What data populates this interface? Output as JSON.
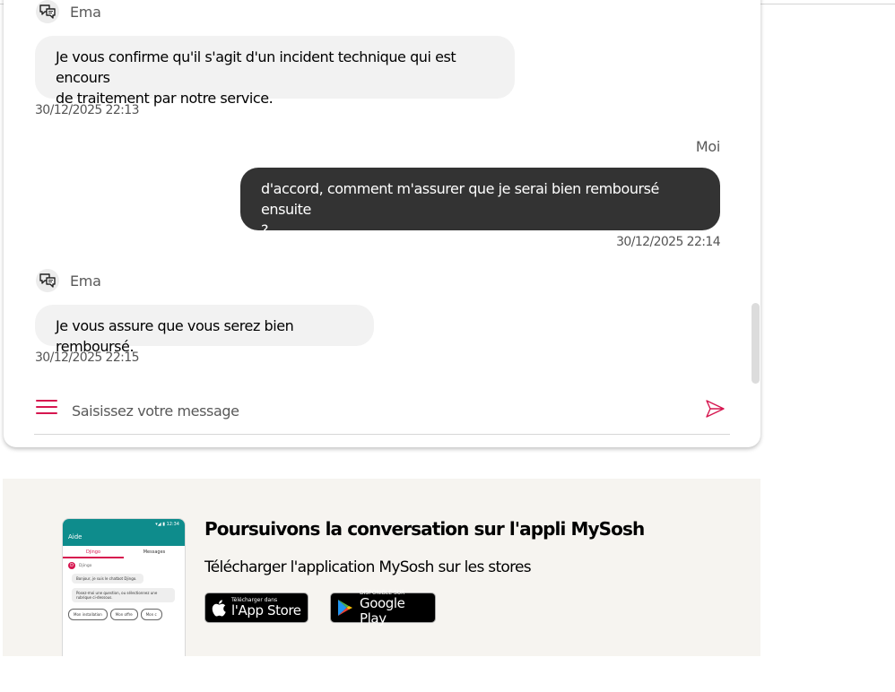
{
  "chat": {
    "messages": [
      {
        "sender": "Ema",
        "text_lines": [
          "Je vous confirme qu'il s'agit d'un incident technique qui est encours",
          "de traitement par notre service."
        ],
        "time": "30/12/2025 22:13"
      },
      {
        "sender": "Moi",
        "text_lines": [
          "d'accord, comment m'assurer que je serai bien remboursé ensuite",
          "?"
        ],
        "time": "30/12/2025 22:14"
      },
      {
        "sender": "Ema",
        "text_lines": [
          "Je vous assure que vous serez bien remboursé."
        ],
        "time": "30/12/2025 22:15"
      }
    ],
    "input": {
      "placeholder": "Saisissez votre message",
      "value": ""
    }
  },
  "promo": {
    "title": "Poursuivons la conversation sur l'appli MySosh",
    "subtitle": "Télécharger l'application MySosh sur les stores",
    "app_store": {
      "small": "Télécharger dans",
      "big": "l'App Store"
    },
    "google_play": {
      "small": "DISPONIBLE SUR",
      "big": "Google Play"
    },
    "phone": {
      "status": "▾◢ ▮ 12:34",
      "title": "Aide",
      "tabs": [
        "Djingo",
        "Messages"
      ],
      "bot_badge": "D",
      "bot_name": "Djingo",
      "bubbles": [
        "Bonjour, je suis le chatbot Djingo.",
        "Posez-moi une question, ou sélectionnez une rubrique ci-dessous."
      ],
      "chips": [
        "Mon installation",
        "Mon offre",
        "Mon c"
      ]
    }
  },
  "colors": {
    "accent": "#d6164f",
    "user_bubble": "#333333",
    "bot_bubble": "#f2f2f2",
    "promo_bg": "#f6f4f0"
  },
  "icons": {
    "sender": "chat-bubbles-icon",
    "menu": "hamburger-menu-icon",
    "send": "send-icon",
    "apple": "apple-logo-icon",
    "google_play": "google-play-logo-icon"
  }
}
